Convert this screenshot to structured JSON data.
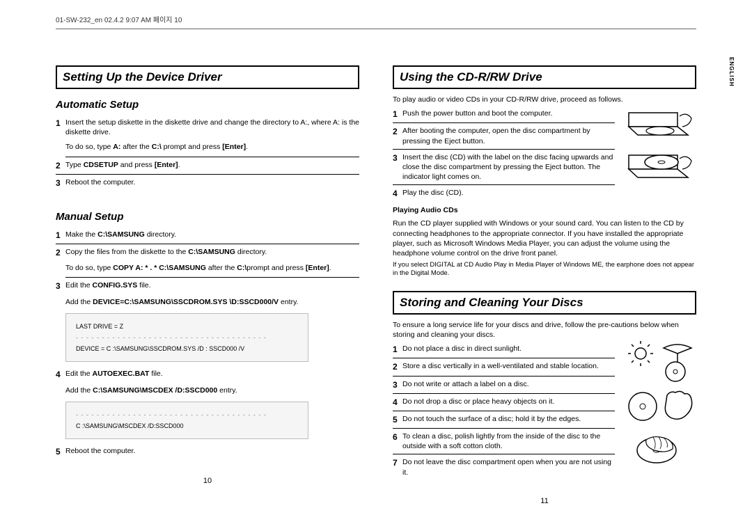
{
  "header": "01-SW-232_en  02.4.2 9:07 AM  페이지 10",
  "english_tab": "ENGLISH",
  "left": {
    "sec1_title": "Setting Up the Device Driver",
    "auto_title": "Automatic Setup",
    "auto_items": {
      "n1": "Insert the setup diskette in the diskette drive and change the directory to A:, where A: is the diskette drive.",
      "n1_sub_pre": "To do so, type ",
      "n1_sub_b1": "A:",
      "n1_sub_mid": " after the ",
      "n1_sub_b2": "C:\\",
      "n1_sub_mid2": " prompt and press ",
      "n1_sub_b3": "[Enter]",
      "n1_sub_end": ".",
      "n2_pre": "Type ",
      "n2_b1": "CDSETUP",
      "n2_mid": " and press ",
      "n2_b2": "[Enter]",
      "n2_end": ".",
      "n3": "Reboot the computer."
    },
    "manual_title": "Manual Setup",
    "manual_items": {
      "n1_pre": "Make the ",
      "n1_b1": "C:\\SAMSUNG",
      "n1_end": " directory.",
      "n2_pre": "Copy the files from the diskette to the ",
      "n2_b1": "C:\\SAMSUNG",
      "n2_end": " directory.",
      "n2_sub_pre": "To do so, type ",
      "n2_sub_b1": "COPY A: * . * C:\\SAMSUNG",
      "n2_sub_mid": " after the ",
      "n2_sub_b2": "C:\\",
      "n2_sub_mid2": "prompt and press ",
      "n2_sub_b3": "[Enter]",
      "n2_sub_end": ".",
      "n3_pre": "Edit the ",
      "n3_b1": "CONFIG.SYS",
      "n3_end": " file.",
      "n3_sub_pre": "Add the ",
      "n3_sub_b1": "DEVICE=C:\\SAMSUNG\\SSCDROM.SYS \\D:SSCD000/V",
      "n3_sub_end": " entry.",
      "code1_l1": "LAST DRIVE = Z",
      "code1_l2": "DEVICE = C :\\SAMSUNG\\SSCDROM.SYS /D : SSCD000 /V",
      "n4_pre": "Edit the ",
      "n4_b1": "AUTOEXEC.BAT",
      "n4_end": " file.",
      "n4_sub_pre": "Add the ",
      "n4_sub_b1": "C:\\SAMSUNG\\MSCDEX /D:SSCD000",
      "n4_sub_end": " entry.",
      "code2_l1": "C :\\SAMSUNG\\MSCDEX /D:SSCD000",
      "n5": "Reboot the computer."
    },
    "pagenum": "10"
  },
  "right": {
    "sec2_title": "Using the CD-R/RW Drive",
    "intro": "To play audio or video CDs in your CD-R/RW drive, proceed as follows.",
    "use_items": {
      "n1": "Push the power button and boot the computer.",
      "n2": "After booting the computer, open the disc compartment by pressing the Eject button.",
      "n3": "Insert the disc (CD) with the label on the disc facing upwards and close the disc compartment by pressing the Eject button. The indicator light comes on.",
      "n4": "Play the disc (CD)."
    },
    "audio_title": "Playing Audio CDs",
    "audio_p1": "Run the CD player supplied with Windows or your sound card. You can listen to the CD by connecting headphones to the appropriate connector. If you have installed the appropriate player, such as Microsoft Windows Media Player, you can adjust the volume using the headphone volume control on the drive front panel.",
    "audio_p2": "If you select DIGITAL at CD Audio Play in Media Player of Windows ME, the earphone does not appear in the Digital Mode.",
    "sec3_title": "Storing and Cleaning Your Discs",
    "store_intro": "To ensure a long service life for your discs and drive, follow the pre-cautions below when storing and cleaning your discs.",
    "store_items": {
      "n1": "Do not place a disc in direct sunlight.",
      "n2": "Store a disc vertically in a well-ventilated and stable location.",
      "n3": "Do not write or attach a label on a disc.",
      "n4": "Do not drop a disc or place heavy objects on it.",
      "n5": "Do not touch the surface of a disc; hold it by the edges.",
      "n6": "To clean a disc, polish lightly from the inside of the disc to the outside with a soft cotton cloth.",
      "n7": "Do not leave the disc compartment open when you are not using it."
    },
    "pagenum": "11"
  },
  "dashes": "- - - - - - - - - - - - - - - - - - - - - - - - - - - - - - - - - - - - -"
}
